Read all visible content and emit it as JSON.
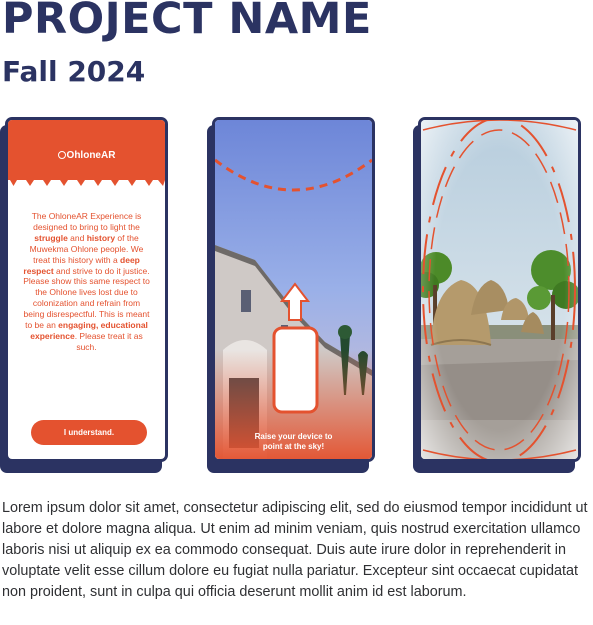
{
  "header": {
    "title": "PROJECT NAME",
    "subtitle": "Fall 2024"
  },
  "colors": {
    "navy": "#2b3362",
    "accent": "#e4522f"
  },
  "card1": {
    "logo_text": "OhloneAR",
    "logo_icon": "ohlone-logo-icon",
    "paragraph": [
      {
        "t": "The OhloneAR Experience is designed to bring to light the ",
        "b": false
      },
      {
        "t": "struggle",
        "b": true
      },
      {
        "t": " and ",
        "b": false
      },
      {
        "t": "history",
        "b": true
      },
      {
        "t": " of the Muwekma Ohlone people. We treat this history with a ",
        "b": false
      },
      {
        "t": "deep respect",
        "b": true
      },
      {
        "t": " and strive to do it justice. Please show this same respect to the Ohlone lives lost due to colonization and refrain from being disrespectful. This is meant to be an ",
        "b": false
      },
      {
        "t": "engaging, educational experience",
        "b": true
      },
      {
        "t": ". Please treat it as such.",
        "b": false
      }
    ],
    "button_label": "I understand."
  },
  "card2": {
    "caption_line1": "Raise your device to",
    "caption_line2": "point at the sky!",
    "icon": "raise-phone-arrow-icon"
  },
  "card3": {
    "scene": "ar-village-view"
  },
  "body_text": "Lorem ipsum dolor sit amet, consectetur adipiscing elit, sed do eiusmod tempor incididunt ut labore et dolore magna aliqua. Ut enim ad minim veniam, quis nostrud exercitation ullamco laboris nisi ut aliquip ex ea commodo consequat. Duis aute irure dolor in reprehenderit in voluptate velit esse cillum dolore eu fugiat nulla pariatur. Excepteur sint occaecat cupidatat non proident, sunt in culpa qui officia deserunt mollit anim id est laborum."
}
